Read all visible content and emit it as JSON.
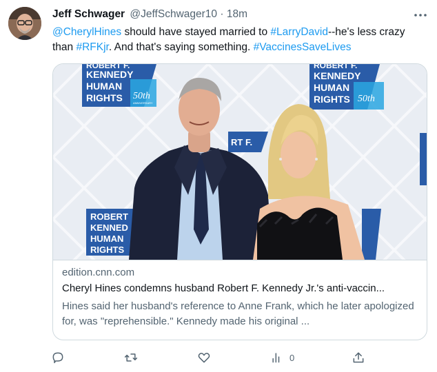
{
  "author": {
    "display_name": "Jeff Schwager",
    "handle": "@JeffSchwager10",
    "separator": "·",
    "time": "18m"
  },
  "tweet": {
    "mention_cheryl": "@CherylHines",
    "text_part1": " should have stayed married to ",
    "mention_larry": "#LarryDavid",
    "text_part2": "--he's less crazy than ",
    "hashtag_rfk": "#RFKjr",
    "text_part3": ". And that's saying something. ",
    "hashtag_vaccines": "#VaccinesSaveLives"
  },
  "card": {
    "domain": "edition.cnn.com",
    "title": "Cheryl Hines condemns husband Robert F. Kennedy Jr.'s anti-vaccin...",
    "description": "Hines said her husband's reference to Anne Frank, which he later apologized for, was \"reprehensible.\" Kennedy made his original ...",
    "backdrop": {
      "logo_lines": [
        "ROBERT F.",
        "KENNEDY",
        "HUMAN",
        "RIGHTS"
      ],
      "logo_anniversary": "50th",
      "logo_anniversary_sub": "ANNIVERSARY",
      "logo_partial": "RT F.",
      "logo_lower_lines": [
        "ROBERT",
        "KENNED",
        "HUMAN",
        "RIGHTS"
      ]
    }
  },
  "actions": {
    "views_count": "0"
  },
  "colors": {
    "accent": "#1d9bf0",
    "secondary_text": "#536471",
    "border": "#cfd9de",
    "logo_blue": "#2a5ca8"
  }
}
